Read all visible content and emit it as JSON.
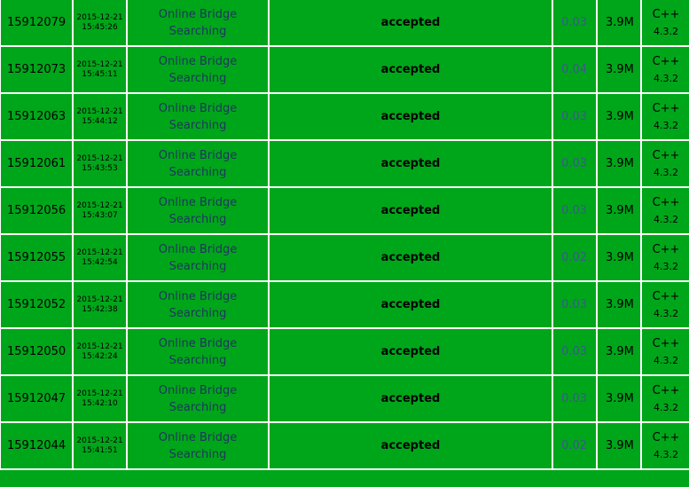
{
  "submissions": [
    {
      "id": "15912079",
      "date": "2015-12-21",
      "time": "15:45:26",
      "problem_line1": "Online Bridge",
      "problem_line2": "Searching",
      "result": "accepted",
      "run_time": "0.03",
      "memory": "3.9M",
      "language": "C++",
      "lang_version": "4.3.2"
    },
    {
      "id": "15912073",
      "date": "2015-12-21",
      "time": "15:45:11",
      "problem_line1": "Online Bridge",
      "problem_line2": "Searching",
      "result": "accepted",
      "run_time": "0.04",
      "memory": "3.9M",
      "language": "C++",
      "lang_version": "4.3.2"
    },
    {
      "id": "15912063",
      "date": "2015-12-21",
      "time": "15:44:12",
      "problem_line1": "Online Bridge",
      "problem_line2": "Searching",
      "result": "accepted",
      "run_time": "0.03",
      "memory": "3.9M",
      "language": "C++",
      "lang_version": "4.3.2"
    },
    {
      "id": "15912061",
      "date": "2015-12-21",
      "time": "15:43:53",
      "problem_line1": "Online Bridge",
      "problem_line2": "Searching",
      "result": "accepted",
      "run_time": "0.03",
      "memory": "3.9M",
      "language": "C++",
      "lang_version": "4.3.2"
    },
    {
      "id": "15912056",
      "date": "2015-12-21",
      "time": "15:43:07",
      "problem_line1": "Online Bridge",
      "problem_line2": "Searching",
      "result": "accepted",
      "run_time": "0.03",
      "memory": "3.9M",
      "language": "C++",
      "lang_version": "4.3.2"
    },
    {
      "id": "15912055",
      "date": "2015-12-21",
      "time": "15:42:54",
      "problem_line1": "Online Bridge",
      "problem_line2": "Searching",
      "result": "accepted",
      "run_time": "0.02",
      "memory": "3.9M",
      "language": "C++",
      "lang_version": "4.3.2"
    },
    {
      "id": "15912052",
      "date": "2015-12-21",
      "time": "15:42:38",
      "problem_line1": "Online Bridge",
      "problem_line2": "Searching",
      "result": "accepted",
      "run_time": "0.03",
      "memory": "3.9M",
      "language": "C++",
      "lang_version": "4.3.2"
    },
    {
      "id": "15912050",
      "date": "2015-12-21",
      "time": "15:42:24",
      "problem_line1": "Online Bridge",
      "problem_line2": "Searching",
      "result": "accepted",
      "run_time": "0.03",
      "memory": "3.9M",
      "language": "C++",
      "lang_version": "4.3.2"
    },
    {
      "id": "15912047",
      "date": "2015-12-21",
      "time": "15:42:10",
      "problem_line1": "Online Bridge",
      "problem_line2": "Searching",
      "result": "accepted",
      "run_time": "0.03",
      "memory": "3.9M",
      "language": "C++",
      "lang_version": "4.3.2"
    },
    {
      "id": "15912044",
      "date": "2015-12-21",
      "time": "15:41:51",
      "problem_line1": "Online Bridge",
      "problem_line2": "Searching",
      "result": "accepted",
      "run_time": "0.02",
      "memory": "3.9M",
      "language": "C++",
      "lang_version": "4.3.2"
    }
  ],
  "colors": {
    "row_background": "#00a61a",
    "cell_border": "#ffffff",
    "problem_link": "#20365f",
    "run_time_text": "#3a5a8a"
  }
}
